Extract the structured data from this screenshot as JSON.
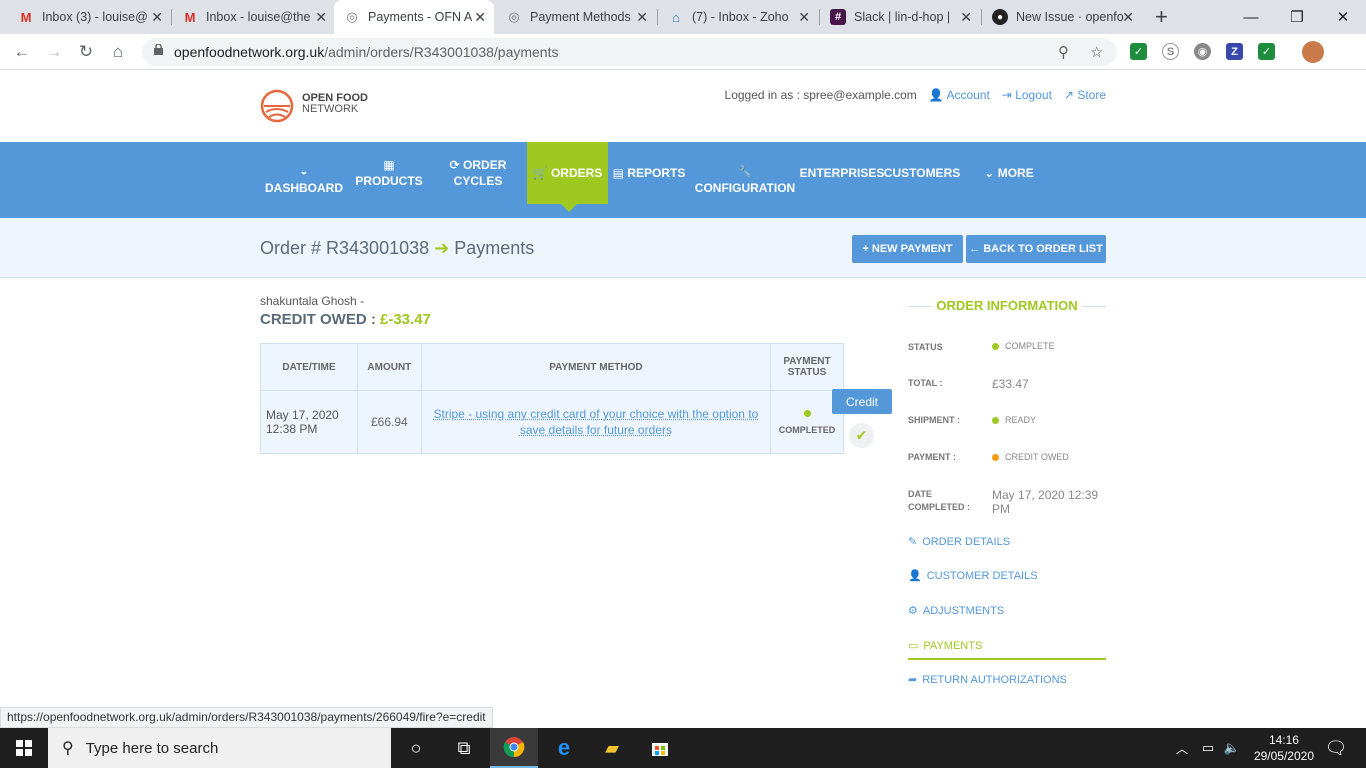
{
  "browser": {
    "tabs": [
      {
        "title": "Inbox (3) - louise@",
        "icon": "gmail-icon"
      },
      {
        "title": "Inbox - louise@the",
        "icon": "gmail-icon"
      },
      {
        "title": "Payments - OFN A",
        "icon": "ofn-icon"
      },
      {
        "title": "Payment Methods",
        "icon": "ofn-icon"
      },
      {
        "title": "(7) - Inbox - Zoho",
        "icon": "zoho-icon"
      },
      {
        "title": "Slack | lin-d-hop |",
        "icon": "slack-icon"
      },
      {
        "title": "New Issue · openfo",
        "icon": "github-icon"
      }
    ],
    "url_host": "openfoodnetwork.org.uk",
    "url_path": "/admin/orders/R343001038/payments",
    "status_url": "https://openfoodnetwork.org.uk/admin/orders/R343001038/payments/266049/fire?e=credit"
  },
  "header": {
    "logo_line1": "OPEN FOOD",
    "logo_line2": "NETWORK",
    "logged_in_as": "Logged in as : spree@example.com",
    "account": "Account",
    "logout": "Logout",
    "store": "Store"
  },
  "nav": {
    "dashboard": "DASHBOARD",
    "products": "PRODUCTS",
    "order_cycles": "ORDER CYCLES",
    "orders": "ORDERS",
    "reports": "REPORTS",
    "configuration": "CONFIGURATION",
    "enterprises": "ENTERPRISES",
    "customers": "CUSTOMERS",
    "more": "MORE"
  },
  "page": {
    "title_order": "Order # R343001038",
    "title_section": "Payments",
    "new_payment": "NEW PAYMENT",
    "back_to_list": "BACK TO ORDER LIST",
    "customer_name": "shakuntala Ghosh -",
    "credit_label": "CREDIT OWED :",
    "credit_value": "£-33.47"
  },
  "table": {
    "headers": {
      "datetime": "DATE/TIME",
      "amount": "AMOUNT",
      "method": "PAYMENT METHOD",
      "status_line1": "PAYMENT",
      "status_line2": "STATUS"
    },
    "row": {
      "date": "May 17, 2020",
      "time": "12:38 PM",
      "amount": "£66.94",
      "method": "Stripe - using any credit card of your choice with the option to save details for future orders",
      "status": "COMPLETED"
    },
    "tooltip": "Credit"
  },
  "sidebar": {
    "title": "ORDER INFORMATION",
    "status_label": "STATUS",
    "status_value": "COMPLETE",
    "total_label": "TOTAL :",
    "total_value": "£33.47",
    "shipment_label": "SHIPMENT :",
    "shipment_value": "READY",
    "payment_label": "PAYMENT :",
    "payment_value": "CREDIT OWED",
    "date_label_1": "DATE",
    "date_label_2": "COMPLETED :",
    "date_value": "May 17, 2020 12:39 PM",
    "links": {
      "order_details": "ORDER DETAILS",
      "customer_details": "CUSTOMER DETAILS",
      "adjustments": "ADJUSTMENTS",
      "payments": "PAYMENTS",
      "return_authorizations": "RETURN AUTHORIZATIONS"
    }
  },
  "taskbar": {
    "search_placeholder": "Type here to search",
    "time": "14:16",
    "date": "29/05/2020"
  },
  "colors": {
    "brand_blue": "#5498da",
    "brand_green": "#9fc820",
    "status_orange": "#f39c12"
  }
}
